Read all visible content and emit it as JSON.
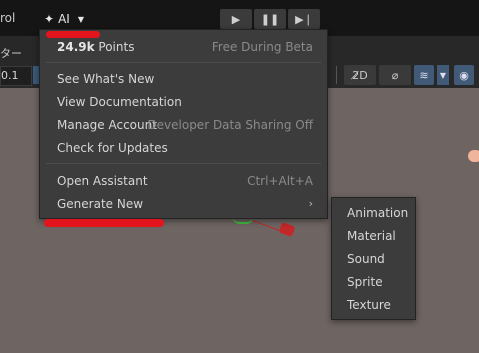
{
  "topbar": {
    "left_label": "rol",
    "ai_label": "AI",
    "ai_icon": "sparkle-icon",
    "play_icon": "play-icon",
    "pause_icon": "pause-icon",
    "step_icon": "step-icon"
  },
  "toolbar2": {
    "jp_label": "ター",
    "number_value": "0.1",
    "tool_icons": [
      "no-2d-icon",
      "no-effects-icon",
      "layers-icon",
      "chevron-down-icon",
      "eye-icon"
    ]
  },
  "menu": {
    "points_value": "24.9k",
    "points_unit": " Points",
    "points_badge": "Free During Beta",
    "items": [
      {
        "label": "See What's New"
      },
      {
        "label": "View Documentation"
      },
      {
        "label": "Manage Account",
        "right": "Developer Data Sharing Off"
      },
      {
        "label": "Check for Updates"
      },
      {
        "label": "Open Assistant",
        "right": "Ctrl+Alt+A"
      },
      {
        "label": "Generate New",
        "right": "›"
      }
    ]
  },
  "submenu": {
    "items": [
      "Animation",
      "Material",
      "Sound",
      "Sprite",
      "Texture"
    ]
  },
  "colors": {
    "topbar_bg": "#151515",
    "menu_bg": "#3c3c3c",
    "scene_bg": "#6e6562",
    "redaction": "#e3141c"
  }
}
